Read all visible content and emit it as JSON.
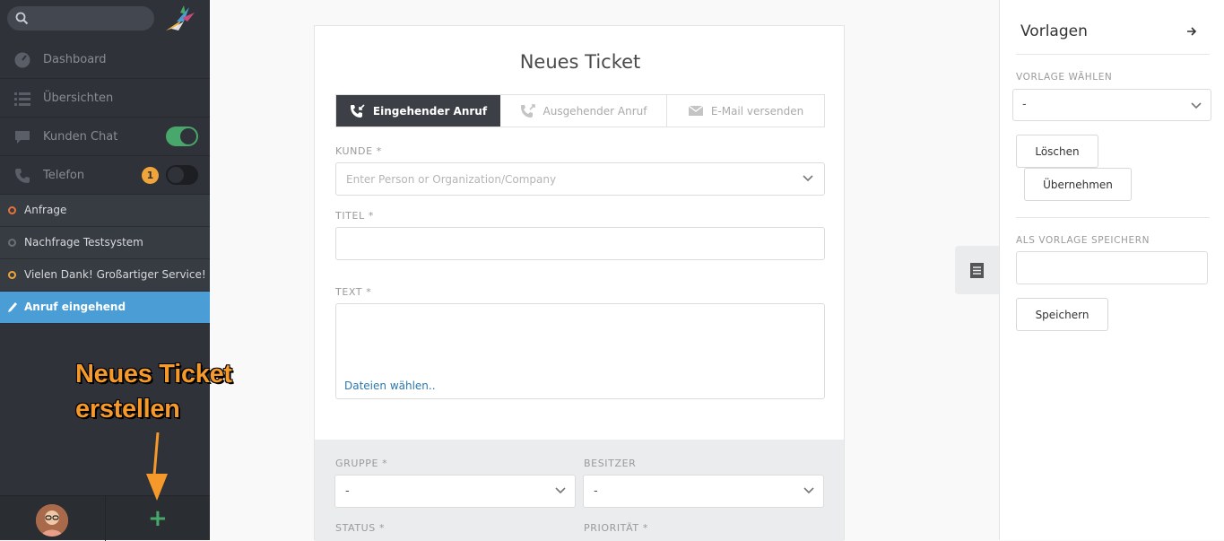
{
  "sidebar": {
    "search": {
      "placeholder": ""
    },
    "nav": [
      {
        "label": "Dashboard",
        "icon": "dashboard-icon"
      },
      {
        "label": "Übersichten",
        "icon": "list-icon"
      },
      {
        "label": "Kunden Chat",
        "icon": "chat-icon",
        "toggle": "on"
      },
      {
        "label": "Telefon",
        "icon": "phone-icon",
        "badge": "1",
        "toggle": "off"
      }
    ],
    "tasks": [
      {
        "label": "Anfrage",
        "status_color": "#e8733a"
      },
      {
        "label": "Nachfrage Testsystem",
        "status_color": "#6b6f76"
      },
      {
        "label": "Vielen Dank! Großartiger Service!",
        "status_color": "#f0a53a"
      },
      {
        "label": "Anruf eingehend",
        "status_color": "#ffffff"
      }
    ],
    "footer": {
      "add_symbol": "+"
    }
  },
  "annotation": {
    "line1": "Neues Ticket",
    "line2": "erstellen",
    "color": "#f59a2a"
  },
  "ticket": {
    "title": "Neues Ticket",
    "tabs": [
      {
        "label": "Eingehender Anruf",
        "icon": "incoming-call-icon",
        "active": true
      },
      {
        "label": "Ausgehender Anruf",
        "icon": "outgoing-call-icon",
        "active": false
      },
      {
        "label": "E-Mail versenden",
        "icon": "envelope-icon",
        "active": false
      }
    ],
    "customer": {
      "label": "KUNDE *",
      "placeholder": "Enter Person or Organization/Company"
    },
    "title_field": {
      "label": "TITEL *",
      "value": ""
    },
    "text_field": {
      "label": "TEXT *",
      "value": "",
      "files_link": "Dateien wählen.."
    },
    "group": {
      "label": "GRUPPE *",
      "value": "-"
    },
    "owner": {
      "label": "BESITZER",
      "value": "-"
    },
    "status": {
      "label": "STATUS *"
    },
    "priority": {
      "label": "PRIORITÄT *"
    }
  },
  "templates": {
    "title": "Vorlagen",
    "choose_label": "VORLAGE WÄHLEN",
    "choose_value": "-",
    "delete_label": "Löschen",
    "apply_label": "Übernehmen",
    "save_as_label": "ALS VORLAGE SPEICHERN",
    "save_as_value": "",
    "save_label": "Speichern"
  },
  "colors": {
    "sidebar_bg": "#2f3238",
    "active_task": "#4b9dd6",
    "toggle_on": "#48a76a",
    "accent_link": "#2b78ae"
  }
}
